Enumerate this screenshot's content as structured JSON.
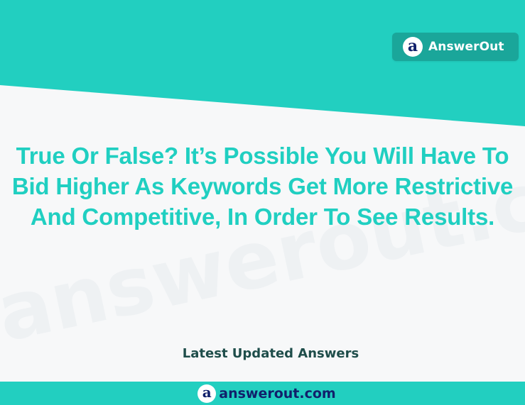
{
  "brand": {
    "logo_glyph": "a",
    "logo_text": "AnswerOut",
    "watermark": "answerout.com"
  },
  "main": {
    "question": "True Or False? It’s Possible You Will Have To Bid Higher As Keywords Get More Restrictive And Competitive, In Order To See Results.",
    "caption": "Latest Updated Answers"
  },
  "footer": {
    "logo_glyph": "a",
    "site": "answerout.com"
  },
  "colors": {
    "teal": "#22cfc0",
    "dark_teal": "#1aa69a",
    "navy": "#11206b",
    "caption": "#1e4d4a",
    "background": "#f7f8f9"
  }
}
